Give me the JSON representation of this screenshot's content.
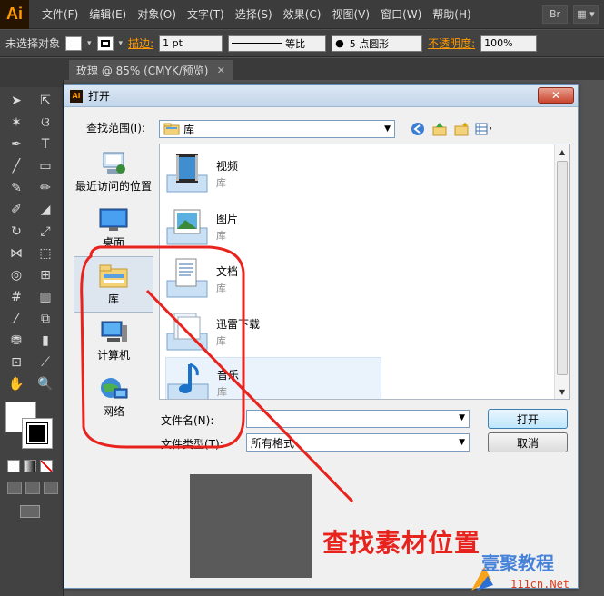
{
  "app": {
    "logo": "Ai",
    "menus": [
      "文件(F)",
      "编辑(E)",
      "对象(O)",
      "文字(T)",
      "选择(S)",
      "效果(C)",
      "视图(V)",
      "窗口(W)",
      "帮助(H)"
    ],
    "menu_icon_br": "Br"
  },
  "controlbar": {
    "selection_text": "未选择对象",
    "stroke_label": "描边:",
    "stroke_weight": "1 pt",
    "stroke_profile": "等比",
    "brush_label": "5 点圆形",
    "opacity_label": "不透明度:",
    "opacity_value": "100%"
  },
  "document_tab": {
    "title": "玫瑰 @ 85% (CMYK/预览)",
    "close": "✕"
  },
  "dialog": {
    "title": "打开",
    "close": "✕",
    "lookin_label": "查找范围(I):",
    "lookin_value": "库",
    "places": [
      {
        "label": "最近访问的位置",
        "icon": "recent-places-icon"
      },
      {
        "label": "桌面",
        "icon": "desktop-icon"
      },
      {
        "label": "库",
        "icon": "library-folder-icon",
        "active": true
      },
      {
        "label": "计算机",
        "icon": "computer-icon"
      },
      {
        "label": "网络",
        "icon": "network-icon"
      }
    ],
    "files": [
      {
        "name": "视频",
        "sub": "库",
        "icon": "video-library-icon"
      },
      {
        "name": "图片",
        "sub": "库",
        "icon": "pictures-library-icon"
      },
      {
        "name": "文档",
        "sub": "库",
        "icon": "documents-library-icon"
      },
      {
        "name": "迅雷下载",
        "sub": "库",
        "icon": "download-library-icon"
      },
      {
        "name": "音乐",
        "sub": "库",
        "icon": "music-library-icon"
      }
    ],
    "filename_label": "文件名(N):",
    "filename_value": "",
    "filetype_label": "文件类型(T):",
    "filetype_value": "所有格式",
    "open_button": "打开",
    "cancel_button": "取消"
  },
  "annotation": {
    "text": "查找素材位置",
    "color": "#e8231e"
  },
  "watermark": {
    "text": "壹聚教程",
    "url": "111cn.Net"
  },
  "colors": {
    "accent_orange": "#ff9a00",
    "annotation_red": "#e8231e"
  }
}
